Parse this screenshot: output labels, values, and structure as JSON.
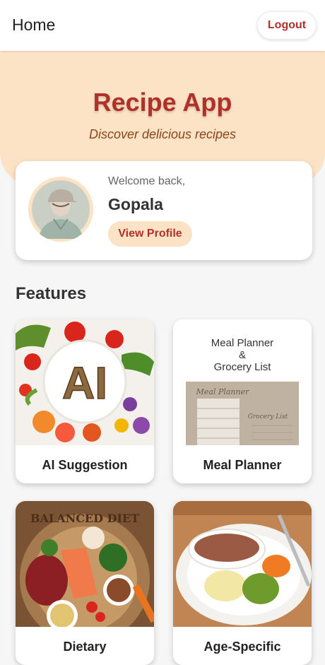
{
  "appbar": {
    "title": "Home",
    "logout_label": "Logout"
  },
  "hero": {
    "title": "Recipe App",
    "subtitle": "Discover delicious recipes"
  },
  "welcome": {
    "greeting": "Welcome back,",
    "username": "Gopala",
    "view_profile_label": "View Profile"
  },
  "features": {
    "title": "Features",
    "items": [
      {
        "label": "AI Suggestion",
        "image_text": "AI"
      },
      {
        "label": "Meal Planner",
        "image_title_1": "Meal Planner",
        "image_title_2": "&",
        "image_title_3": "Grocery List",
        "image_note_1": "Meal Planner",
        "image_note_2": "Grocery List"
      },
      {
        "label": "Dietary",
        "image_text": "BALANCED DIET"
      },
      {
        "label": "Age-Specific"
      }
    ]
  },
  "colors": {
    "accent": "#b0312a",
    "hero_bg": "#fde3c5",
    "subtitle": "#8a4418",
    "page_bg": "#f6f6f6"
  }
}
